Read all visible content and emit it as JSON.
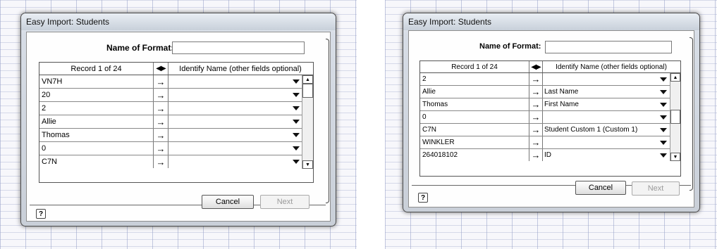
{
  "dialogs": [
    {
      "title": "Easy Import: Students",
      "format_label": "Name of Format:",
      "format_value": "",
      "record_header": "Record 1 of 24",
      "header_arrows": "◀▶",
      "map_header": "Identify Name (other fields optional)",
      "rows": [
        {
          "value": "VN7H",
          "arrow": "→",
          "map": ""
        },
        {
          "value": "20",
          "arrow": "→",
          "map": ""
        },
        {
          "value": "2",
          "arrow": "→",
          "map": ""
        },
        {
          "value": "Allie",
          "arrow": "→",
          "map": ""
        },
        {
          "value": "Thomas",
          "arrow": "→",
          "map": ""
        },
        {
          "value": "0",
          "arrow": "→",
          "map": ""
        },
        {
          "value": "C7N",
          "arrow": "→",
          "map": ""
        }
      ],
      "cancel_label": "Cancel",
      "next_label": "Next",
      "help_label": "?"
    },
    {
      "title": "Easy Import: Students",
      "format_label": "Name of Format:",
      "format_value": "",
      "record_header": "Record 1 of 24",
      "header_arrows": "◀▶",
      "map_header": "Identify Name (other fields optional)",
      "rows": [
        {
          "value": "2",
          "arrow": "→",
          "map": ""
        },
        {
          "value": "Allie",
          "arrow": "→",
          "map": "Last Name"
        },
        {
          "value": "Thomas",
          "arrow": "→",
          "map": "First Name"
        },
        {
          "value": "0",
          "arrow": "→",
          "map": ""
        },
        {
          "value": "C7N",
          "arrow": "→",
          "map": "Student Custom 1 (Custom 1)"
        },
        {
          "value": "WINKLER",
          "arrow": "→",
          "map": ""
        },
        {
          "value": "264018102",
          "arrow": "→",
          "map": "ID"
        }
      ],
      "cancel_label": "Cancel",
      "next_label": "Next",
      "help_label": "?"
    }
  ],
  "icons": {
    "dropdown": "triangle-down",
    "scroll_up": "▲",
    "scroll_down": "▼"
  }
}
